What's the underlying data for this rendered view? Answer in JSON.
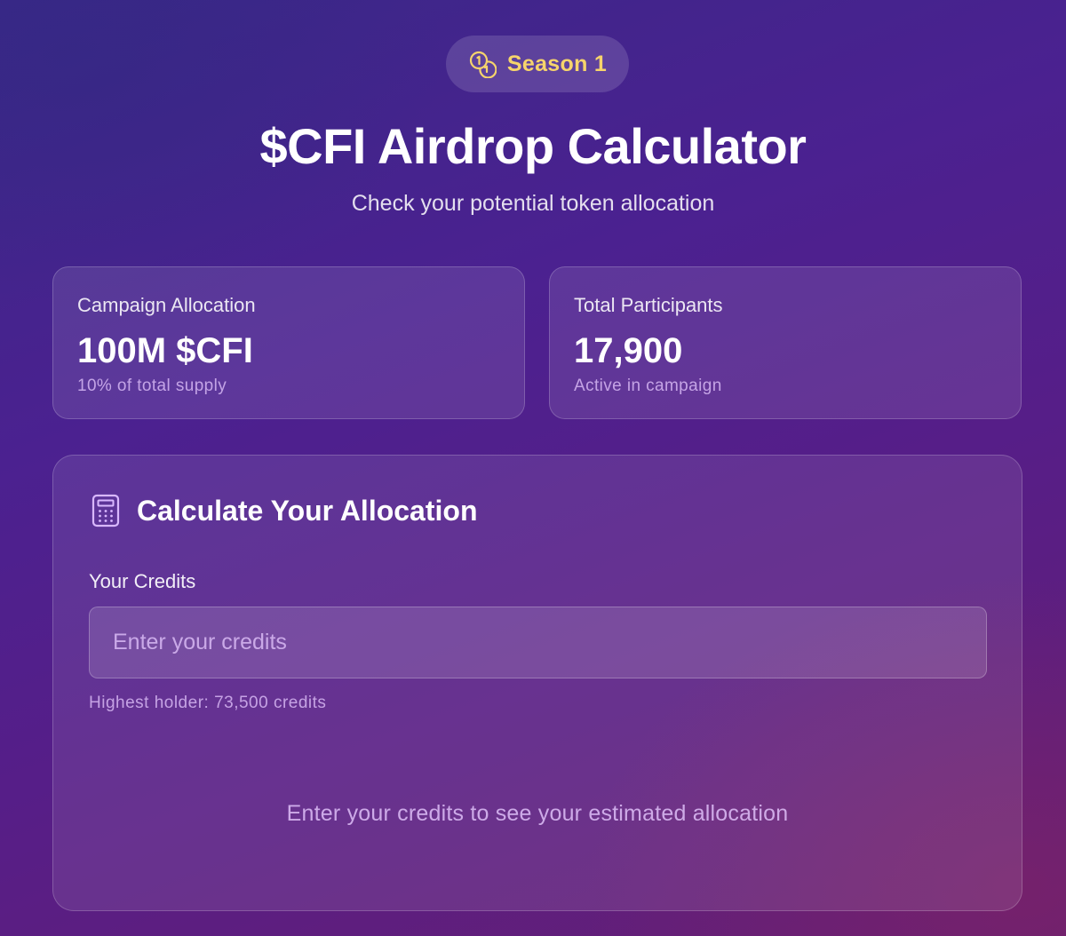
{
  "season": {
    "icon": "coins-icon",
    "label": "Season 1",
    "accent_color": "#f6d46b"
  },
  "header": {
    "title": "$CFI Airdrop Calculator",
    "subtitle": "Check your potential token allocation"
  },
  "stats": [
    {
      "label": "Campaign Allocation",
      "value": "100M $CFI",
      "sub": "10% of total supply"
    },
    {
      "label": "Total Participants",
      "value": "17,900",
      "sub": "Active in campaign"
    }
  ],
  "calculator": {
    "icon": "calculator-icon",
    "title": "Calculate Your Allocation",
    "credits_label": "Your Credits",
    "credits_value": "",
    "credits_placeholder": "Enter your credits",
    "highest_holder": "Highest holder: 73,500 credits",
    "result_hint": "Enter your credits to see your estimated allocation"
  },
  "colors": {
    "background_start": "#3a2888",
    "background_end": "#661f74",
    "accent": "#f6d46b",
    "muted_text": "#e6c8ff"
  }
}
